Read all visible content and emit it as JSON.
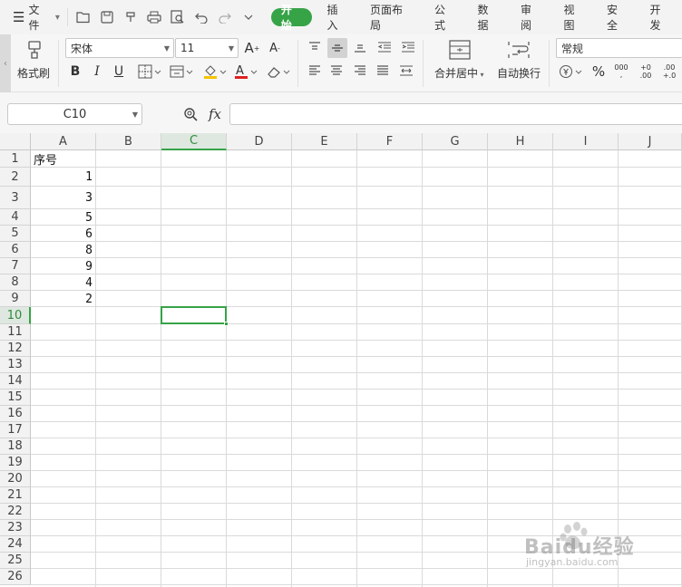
{
  "menubar": {
    "file_label": "文件",
    "quick_icons": [
      "open-folder-icon",
      "save-icon",
      "format-painter-quick-icon",
      "print-icon",
      "print-preview-icon",
      "undo-icon",
      "redo-icon",
      "more-icon"
    ],
    "tabs": [
      {
        "label": "开始",
        "active": true
      },
      {
        "label": "插入"
      },
      {
        "label": "页面布局"
      },
      {
        "label": "公式"
      },
      {
        "label": "数据"
      },
      {
        "label": "审阅"
      },
      {
        "label": "视图"
      },
      {
        "label": "安全"
      },
      {
        "label": "开发"
      }
    ]
  },
  "ribbon": {
    "format_painter_label": "格式刷",
    "font_name": "宋体",
    "font_size": "11",
    "merge_center_label": "合并居中",
    "wrap_text_label": "自动换行",
    "number_format": "常规",
    "percent_symbol": "%",
    "thousands_symbol": "000",
    "increase_decimal_top": "+0",
    "increase_decimal_bottom": ".00",
    "decrease_decimal_top": ".00",
    "decrease_decimal_bottom": "+.0",
    "font_color": "#e02020",
    "fill_color": "#f5c400"
  },
  "formula_bar": {
    "name_box": "C10",
    "fx_label": "fx",
    "value": ""
  },
  "sheet": {
    "columns": [
      "A",
      "B",
      "C",
      "D",
      "E",
      "F",
      "G",
      "H",
      "I",
      "J"
    ],
    "active_column": "C",
    "rows": [
      "1",
      "2",
      "3",
      "4",
      "5",
      "6",
      "7",
      "8",
      "9",
      "10",
      "11",
      "12",
      "13",
      "14",
      "15",
      "16",
      "17",
      "18",
      "19",
      "20",
      "21",
      "22",
      "23",
      "24",
      "25",
      "26"
    ],
    "active_row": "10",
    "cells": {
      "A1": "序号",
      "A2": "1",
      "A3": "3",
      "A4": "5",
      "A5": "6",
      "A6": "8",
      "A7": "9",
      "A8": "4",
      "A9": "2"
    },
    "accent_color": "#36a347"
  },
  "watermark": {
    "brand": "Baidu经验",
    "url": "jingyan.baidu.com"
  }
}
